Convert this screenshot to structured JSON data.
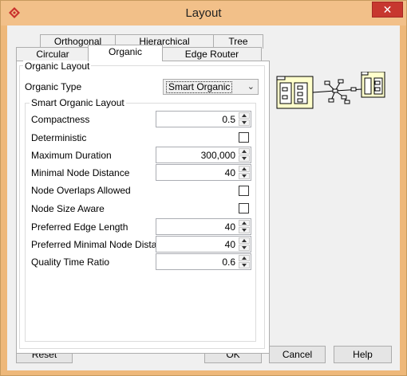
{
  "window": {
    "title": "Layout",
    "close_label": "✕"
  },
  "tabs_row1": [
    {
      "label": "Orthogonal"
    },
    {
      "label": "Hierarchical"
    },
    {
      "label": "Tree"
    }
  ],
  "tabs_row2": [
    {
      "label": "Circular"
    },
    {
      "label": "Organic",
      "selected": true
    },
    {
      "label": "Edge Router"
    }
  ],
  "organic_layout": {
    "group_title": "Organic Layout",
    "organic_type_label": "Organic Type",
    "organic_type_value": "Smart Organic",
    "smart_group_title": "Smart Organic Layout",
    "compactness_label": "Compactness",
    "compactness_value": "0.5",
    "deterministic_label": "Deterministic",
    "deterministic_checked": false,
    "max_duration_label": "Maximum Duration",
    "max_duration_value": "300,000",
    "min_node_distance_label": "Minimal Node Distance",
    "min_node_distance_value": "40",
    "node_overlaps_label": "Node Overlaps Allowed",
    "node_overlaps_checked": false,
    "node_size_aware_label": "Node Size Aware",
    "node_size_aware_checked": false,
    "pref_edge_length_label": "Preferred Edge Length",
    "pref_edge_length_value": "40",
    "pref_min_node_distance_label": "Preferred Minimal Node Distance",
    "pref_min_node_distance_value": "40",
    "quality_time_ratio_label": "Quality Time Ratio",
    "quality_time_ratio_value": "0.6"
  },
  "buttons": {
    "reset": "Reset",
    "ok": "OK",
    "cancel": "Cancel",
    "help": "Help"
  },
  "colors": {
    "titlebar": "#f2c089",
    "close": "#c7372f",
    "node_fill": "#ffffcc"
  }
}
